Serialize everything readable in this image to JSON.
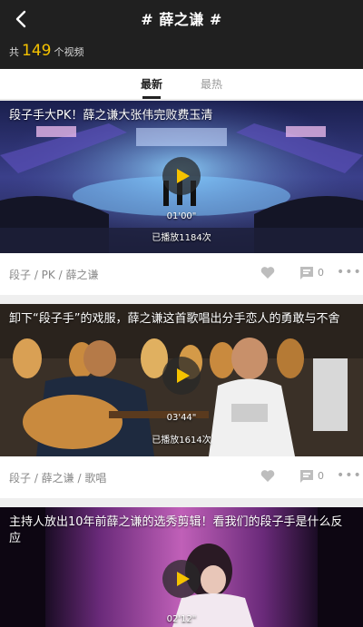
{
  "header": {
    "title": "# 薛之谦 #",
    "count_prefix": "共",
    "count_value": "149",
    "count_suffix": "个视频"
  },
  "tabs": [
    {
      "label": "最新",
      "active": true
    },
    {
      "label": "最热",
      "active": false
    }
  ],
  "videos": [
    {
      "title": "段子手大PK！薛之谦大张伟完败费玉清",
      "duration": "01'00\"",
      "plays": "已播放1184次",
      "tags": "段子 / PK / 薛之谦",
      "comments": "0"
    },
    {
      "title": "卸下“段子手”的戏服，薛之谦这首歌唱出分手恋人的勇敢与不舍",
      "duration": "03'44\"",
      "plays": "已播放1614次",
      "tags": "段子 / 薛之谦 / 歌唱",
      "comments": "0"
    },
    {
      "title": "主持人放出10年前薛之谦的选秀剪辑！看我们的段子手是什么反应",
      "duration": "02'12\""
    }
  ],
  "colors": {
    "header_bg": "#202020",
    "accent": "#f5c200",
    "play_icon": "#f5c200"
  }
}
